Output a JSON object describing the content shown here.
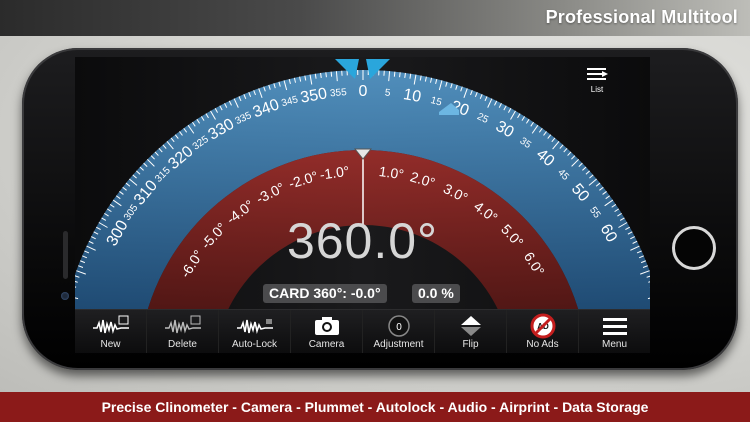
{
  "headline": "Professional Multitool",
  "banner": "Precise Clinometer - Camera - Plummet - Autolock - Audio - Airprint - Data Storage",
  "list_button": {
    "label": "List",
    "icon": "list-icon"
  },
  "readout": {
    "angle": "360.0°",
    "card_label": "CARD 360°: -0.0°",
    "percent": "0.0 %"
  },
  "dial": {
    "outer_ticks": [
      {
        "label": "0",
        "deg": 0
      },
      {
        "label": "5",
        "deg": 5
      },
      {
        "label": "10",
        "deg": 10
      },
      {
        "label": "15",
        "deg": 15
      },
      {
        "label": "20",
        "deg": 20
      },
      {
        "label": "25",
        "deg": 25
      },
      {
        "label": "30",
        "deg": 30
      },
      {
        "label": "35",
        "deg": 35
      },
      {
        "label": "40",
        "deg": 40
      },
      {
        "label": "45",
        "deg": 45
      },
      {
        "label": "50",
        "deg": 50
      },
      {
        "label": "55",
        "deg": 55
      },
      {
        "label": "60",
        "deg": 60
      },
      {
        "label": "355",
        "deg": -5
      },
      {
        "label": "350",
        "deg": -10
      },
      {
        "label": "345",
        "deg": -15
      },
      {
        "label": "340",
        "deg": -20
      },
      {
        "label": "335",
        "deg": -25
      },
      {
        "label": "330",
        "deg": -30
      },
      {
        "label": "325",
        "deg": -35
      },
      {
        "label": "320",
        "deg": -40
      },
      {
        "label": "315",
        "deg": -45
      },
      {
        "label": "310",
        "deg": -50
      },
      {
        "label": "305",
        "deg": -55
      },
      {
        "label": "300",
        "deg": -60
      }
    ],
    "inner_ticks": [
      {
        "label": "1.0°",
        "deg": 8
      },
      {
        "label": "2.0°",
        "deg": 17
      },
      {
        "label": "3.0°",
        "deg": 27
      },
      {
        "label": "4.0°",
        "deg": 37
      },
      {
        "label": "5.0°",
        "deg": 47
      },
      {
        "label": "6.0°",
        "deg": 57
      },
      {
        "label": "-1.0°",
        "deg": -8
      },
      {
        "label": "-2.0°",
        "deg": -17
      },
      {
        "label": "-3.0°",
        "deg": -27
      },
      {
        "label": "-4.0°",
        "deg": -37
      },
      {
        "label": "-5.0°",
        "deg": -47
      },
      {
        "label": "-6.0°",
        "deg": -57
      }
    ],
    "colors": {
      "outer": "#2b6aa3",
      "inner": "#7a1e1c",
      "marker": "#1fa0d8"
    }
  },
  "toolbar": [
    {
      "label": "New",
      "icon": "waveform-new-icon"
    },
    {
      "label": "Delete",
      "icon": "waveform-delete-icon"
    },
    {
      "label": "Auto-Lock",
      "icon": "waveform-lock-icon"
    },
    {
      "label": "Camera",
      "icon": "camera-icon"
    },
    {
      "label": "Adjustment",
      "icon": "adjustment-icon",
      "value": "0"
    },
    {
      "label": "Flip",
      "icon": "flip-icon"
    },
    {
      "label": "No Ads",
      "icon": "no-ads-icon"
    },
    {
      "label": "Menu",
      "icon": "menu-icon"
    }
  ]
}
